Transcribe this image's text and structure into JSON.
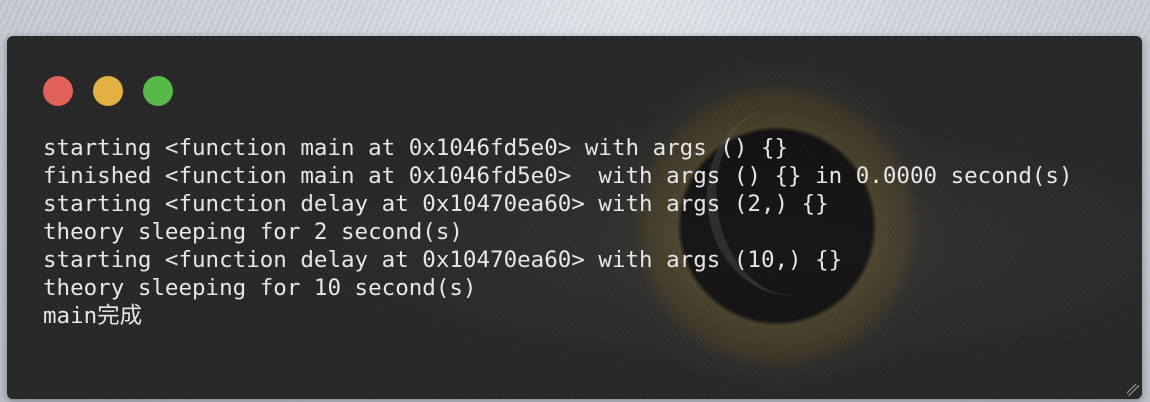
{
  "window": {
    "controls": [
      "close",
      "minimize",
      "maximize"
    ]
  },
  "console": {
    "lines": [
      "starting <function main at 0x1046fd5e0> with args () {}",
      "finished <function main at 0x1046fd5e0>  with args () {} in 0.0000 second(s)",
      "starting <function delay at 0x10470ea60> with args (2,) {}",
      "theory sleeping for 2 second(s)",
      "starting <function delay at 0x10470ea60> with args (10,) {}",
      "theory sleeping for 10 second(s)",
      "main完成"
    ]
  },
  "colors": {
    "close": "#e0605a",
    "minimize": "#e3b042",
    "maximize": "#56b948",
    "terminal_bg": "#232323",
    "text": "#e6e6e6"
  }
}
